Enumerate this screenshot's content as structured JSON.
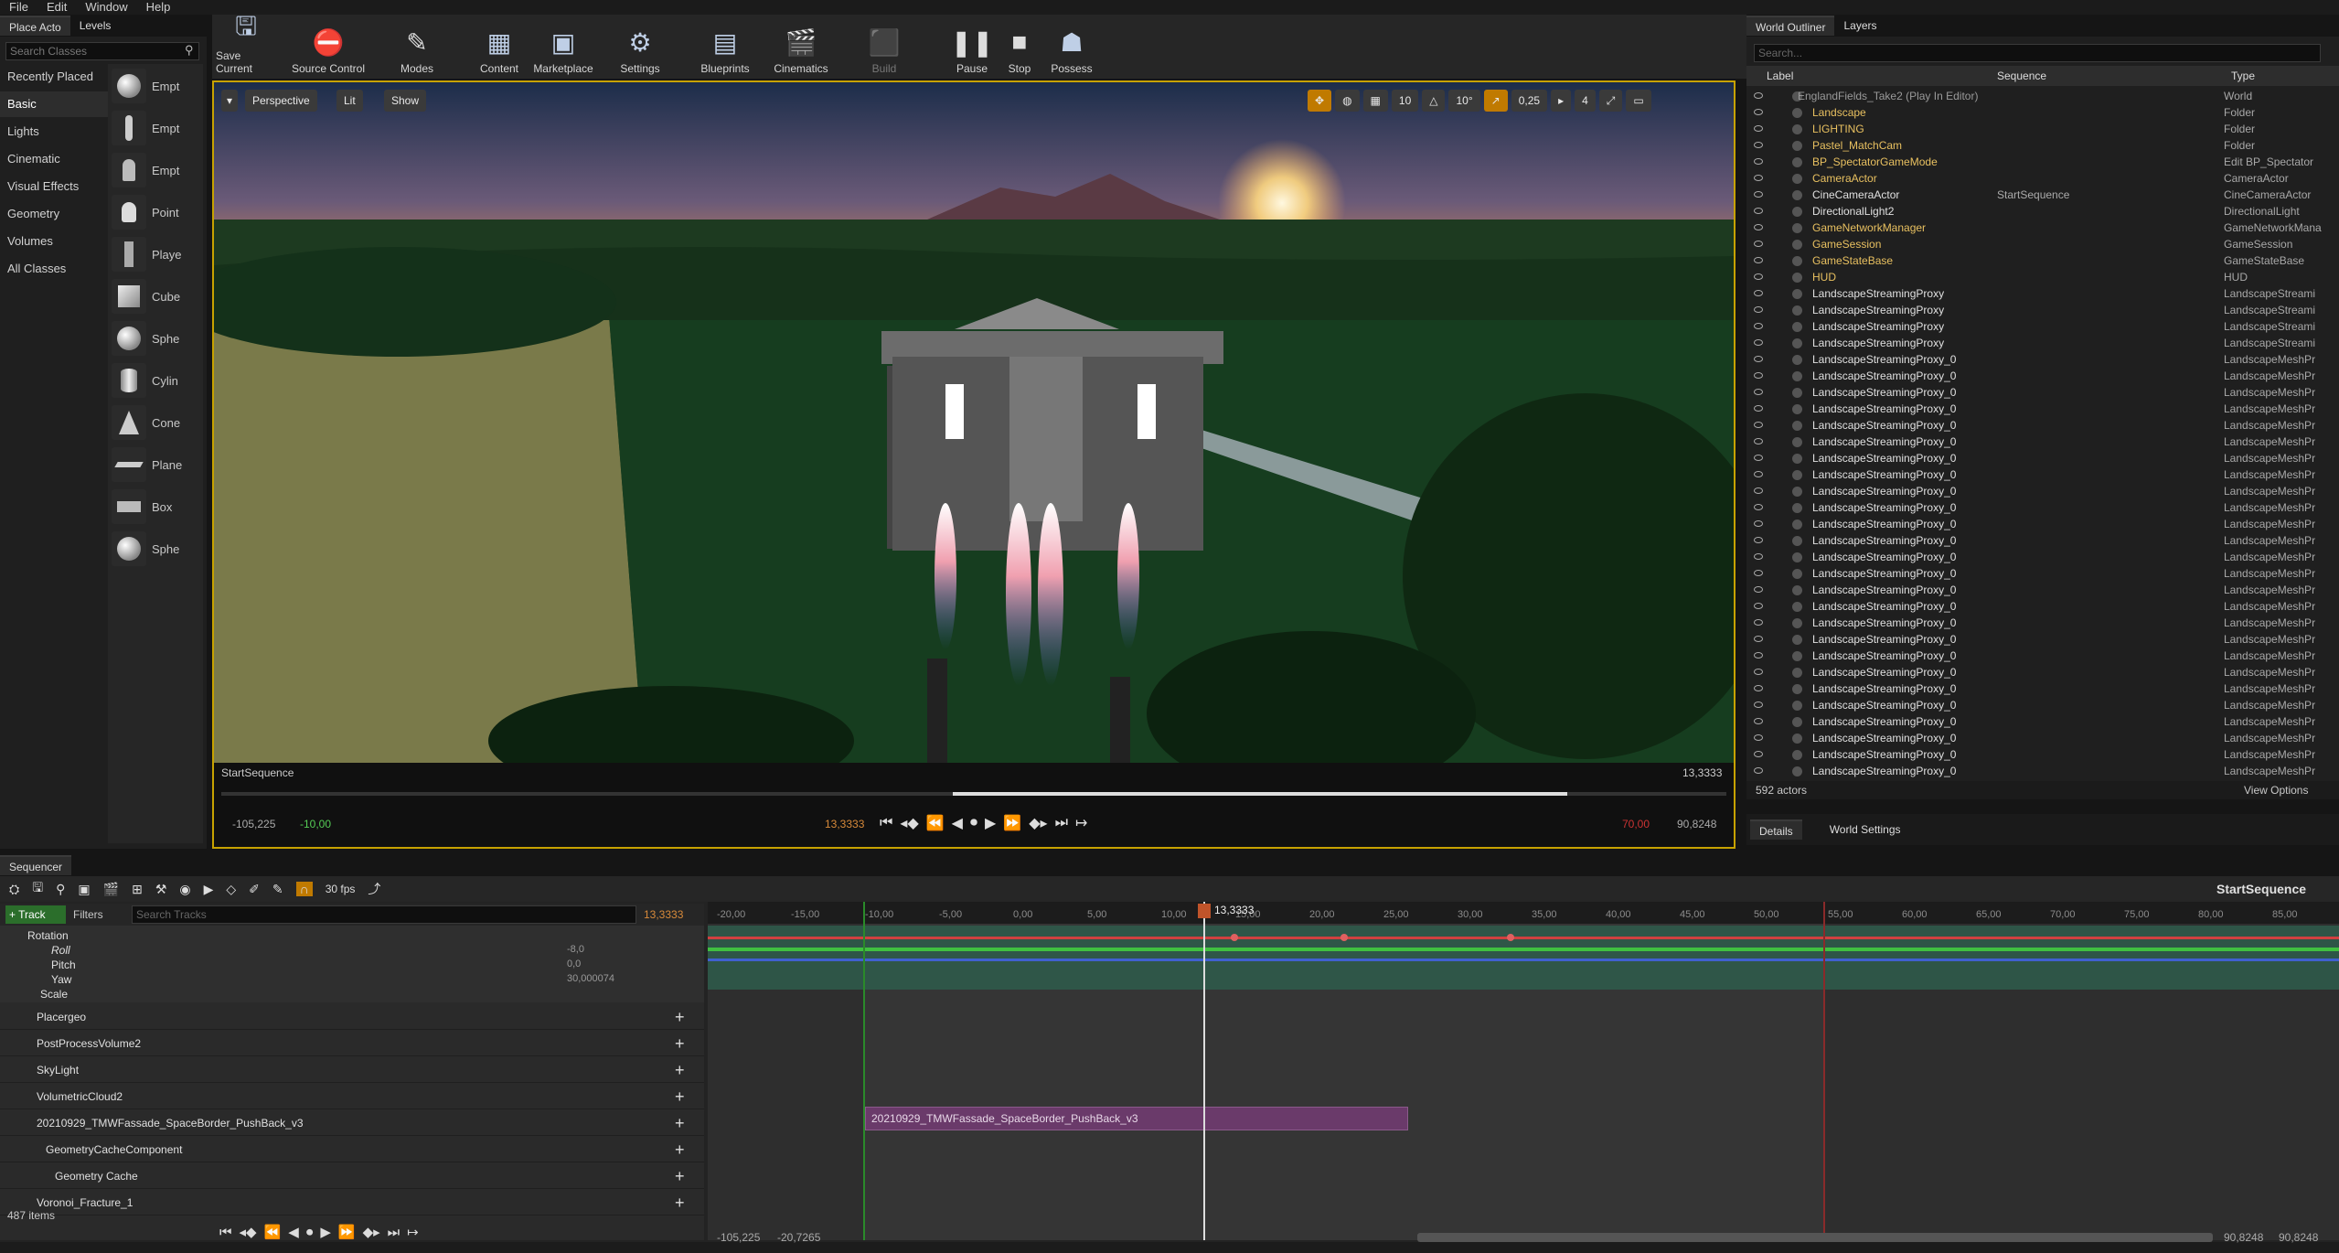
{
  "menu": [
    "File",
    "Edit",
    "Window",
    "Help"
  ],
  "place_actors": {
    "tabs": [
      "Place Acto",
      "Levels"
    ],
    "search_placeholder": "Search Classes",
    "categories": [
      "Recently Placed",
      "Basic",
      "Lights",
      "Cinematic",
      "Visual Effects",
      "Geometry",
      "Volumes",
      "All Classes"
    ],
    "items": [
      "Empt",
      "Empt",
      "Empt",
      "Point",
      "Playe",
      "Cube",
      "Sphe",
      "Cylin",
      "Cone",
      "Plane",
      "Box",
      "Sphe"
    ]
  },
  "toolbar": {
    "buttons": [
      "Save Current",
      "Source Control",
      "Modes",
      "Content",
      "Marketplace",
      "Settings",
      "Blueprints",
      "Cinematics",
      "Build",
      "Pause",
      "Stop",
      "Possess"
    ]
  },
  "viewport": {
    "view_mode": "Perspective",
    "lighting": "Lit",
    "show": "Show",
    "grid": "10",
    "angle": "10°",
    "scale": "0,25",
    "speed": "4",
    "sequence_name": "StartSequence",
    "current_time": "13,3333",
    "range_start": "-105,225",
    "range_start2": "-10,00",
    "play_time": "13,3333",
    "range_end": "70,00",
    "range_end2": "90,8248"
  },
  "outliner": {
    "tabs": [
      "World Outliner",
      "Layers"
    ],
    "search_placeholder": "Search...",
    "columns": [
      "Label",
      "Sequence",
      "Type"
    ],
    "rows": [
      {
        "label": "EnglandFields_Take2 (Play In Editor)",
        "seq": "",
        "type": "World",
        "color": "#9a9a9a"
      },
      {
        "label": "Landscape",
        "seq": "",
        "type": "Folder",
        "color": "#e8c060"
      },
      {
        "label": "LIGHTING",
        "seq": "",
        "type": "Folder",
        "color": "#e8c060"
      },
      {
        "label": "Pastel_MatchCam",
        "seq": "",
        "type": "Folder",
        "color": "#e8c060"
      },
      {
        "label": "BP_SpectatorGameMode",
        "seq": "",
        "type": "Edit BP_Spectator",
        "color": "#e8c060"
      },
      {
        "label": "CameraActor",
        "seq": "",
        "type": "CameraActor",
        "color": "#e8c060"
      },
      {
        "label": "CineCameraActor",
        "seq": "StartSequence",
        "type": "CineCameraActor",
        "color": "#e0e0e0"
      },
      {
        "label": "DirectionalLight2",
        "seq": "",
        "type": "DirectionalLight",
        "color": "#e0e0e0"
      },
      {
        "label": "GameNetworkManager",
        "seq": "",
        "type": "GameNetworkMana",
        "color": "#e8c060"
      },
      {
        "label": "GameSession",
        "seq": "",
        "type": "GameSession",
        "color": "#e8c060"
      },
      {
        "label": "GameStateBase",
        "seq": "",
        "type": "GameStateBase",
        "color": "#e8c060"
      },
      {
        "label": "HUD",
        "seq": "",
        "type": "HUD",
        "color": "#e8c060"
      },
      {
        "label": "LandscapeStreamingProxy",
        "seq": "",
        "type": "LandscapeStreami",
        "color": "#e0e0e0"
      },
      {
        "label": "LandscapeStreamingProxy",
        "seq": "",
        "type": "LandscapeStreami",
        "color": "#e0e0e0"
      },
      {
        "label": "LandscapeStreamingProxy",
        "seq": "",
        "type": "LandscapeStreami",
        "color": "#e0e0e0"
      },
      {
        "label": "LandscapeStreamingProxy",
        "seq": "",
        "type": "LandscapeStreami",
        "color": "#e0e0e0"
      },
      {
        "label": "LandscapeStreamingProxy_0",
        "seq": "",
        "type": "LandscapeMeshPr",
        "color": "#e0e0e0"
      },
      {
        "label": "LandscapeStreamingProxy_0",
        "seq": "",
        "type": "LandscapeMeshPr",
        "color": "#e0e0e0"
      },
      {
        "label": "LandscapeStreamingProxy_0",
        "seq": "",
        "type": "LandscapeMeshPr",
        "color": "#e0e0e0"
      },
      {
        "label": "LandscapeStreamingProxy_0",
        "seq": "",
        "type": "LandscapeMeshPr",
        "color": "#e0e0e0"
      },
      {
        "label": "LandscapeStreamingProxy_0",
        "seq": "",
        "type": "LandscapeMeshPr",
        "color": "#e0e0e0"
      },
      {
        "label": "LandscapeStreamingProxy_0",
        "seq": "",
        "type": "LandscapeMeshPr",
        "color": "#e0e0e0"
      },
      {
        "label": "LandscapeStreamingProxy_0",
        "seq": "",
        "type": "LandscapeMeshPr",
        "color": "#e0e0e0"
      },
      {
        "label": "LandscapeStreamingProxy_0",
        "seq": "",
        "type": "LandscapeMeshPr",
        "color": "#e0e0e0"
      },
      {
        "label": "LandscapeStreamingProxy_0",
        "seq": "",
        "type": "LandscapeMeshPr",
        "color": "#e0e0e0"
      },
      {
        "label": "LandscapeStreamingProxy_0",
        "seq": "",
        "type": "LandscapeMeshPr",
        "color": "#e0e0e0"
      },
      {
        "label": "LandscapeStreamingProxy_0",
        "seq": "",
        "type": "LandscapeMeshPr",
        "color": "#e0e0e0"
      },
      {
        "label": "LandscapeStreamingProxy_0",
        "seq": "",
        "type": "LandscapeMeshPr",
        "color": "#e0e0e0"
      },
      {
        "label": "LandscapeStreamingProxy_0",
        "seq": "",
        "type": "LandscapeMeshPr",
        "color": "#e0e0e0"
      },
      {
        "label": "LandscapeStreamingProxy_0",
        "seq": "",
        "type": "LandscapeMeshPr",
        "color": "#e0e0e0"
      },
      {
        "label": "LandscapeStreamingProxy_0",
        "seq": "",
        "type": "LandscapeMeshPr",
        "color": "#e0e0e0"
      },
      {
        "label": "LandscapeStreamingProxy_0",
        "seq": "",
        "type": "LandscapeMeshPr",
        "color": "#e0e0e0"
      },
      {
        "label": "LandscapeStreamingProxy_0",
        "seq": "",
        "type": "LandscapeMeshPr",
        "color": "#e0e0e0"
      },
      {
        "label": "LandscapeStreamingProxy_0",
        "seq": "",
        "type": "LandscapeMeshPr",
        "color": "#e0e0e0"
      },
      {
        "label": "LandscapeStreamingProxy_0",
        "seq": "",
        "type": "LandscapeMeshPr",
        "color": "#e0e0e0"
      },
      {
        "label": "LandscapeStreamingProxy_0",
        "seq": "",
        "type": "LandscapeMeshPr",
        "color": "#e0e0e0"
      },
      {
        "label": "LandscapeStreamingProxy_0",
        "seq": "",
        "type": "LandscapeMeshPr",
        "color": "#e0e0e0"
      },
      {
        "label": "LandscapeStreamingProxy_0",
        "seq": "",
        "type": "LandscapeMeshPr",
        "color": "#e0e0e0"
      },
      {
        "label": "LandscapeStreamingProxy_0",
        "seq": "",
        "type": "LandscapeMeshPr",
        "color": "#e0e0e0"
      },
      {
        "label": "LandscapeStreamingProxy_0",
        "seq": "",
        "type": "LandscapeMeshPr",
        "color": "#e0e0e0"
      },
      {
        "label": "LandscapeStreamingProxy_0",
        "seq": "",
        "type": "LandscapeMeshPr",
        "color": "#e0e0e0"
      },
      {
        "label": "LandscapeStreamingProxy_0",
        "seq": "",
        "type": "LandscapeMeshPr",
        "color": "#e0e0e0"
      }
    ],
    "actor_count": "592 actors",
    "view_options": "View Options"
  },
  "details": {
    "tabs": [
      "Details",
      "World Settings"
    ]
  },
  "sequencer": {
    "tab": "Sequencer",
    "fps": "30 fps",
    "title": "StartSequence",
    "track_button": "Track",
    "filters": "Filters",
    "search_placeholder": "Search Tracks",
    "current_time": "13,3333",
    "playhead_label": "13,3333",
    "ruler": [
      "-20,00",
      "-15,00",
      "-10,00",
      "-5,00",
      "0,00",
      "5,00",
      "10,00",
      "15,00",
      "20,00",
      "25,00",
      "30,00",
      "35,00",
      "40,00",
      "45,00",
      "50,00",
      "55,00",
      "60,00",
      "65,00",
      "70,00",
      "75,00",
      "80,00",
      "85,00"
    ],
    "transform": [
      {
        "name": "Rotation",
        "value": ""
      },
      {
        "name": "Roll",
        "value": "-8,0"
      },
      {
        "name": "Pitch",
        "value": "0,0"
      },
      {
        "name": "Yaw",
        "value": "30,000074"
      },
      {
        "name": "Scale",
        "value": ""
      }
    ],
    "tracks": [
      "Placergeo",
      "PostProcessVolume2",
      "SkyLight",
      "VolumetricCloud2",
      "20210929_TMWFassade_SpaceBorder_PushBack_v3",
      "GeometryCacheComponent",
      "Geometry Cache",
      "Voronoi_Fracture_1"
    ],
    "clip_label": "20210929_TMWFassade_SpaceBorder_PushBack_v3",
    "item_count": "487 items",
    "bottom_start": "-105,225",
    "bottom_start2": "-20,7265",
    "bottom_end": "90,8248",
    "bottom_end2": "90,8248"
  }
}
